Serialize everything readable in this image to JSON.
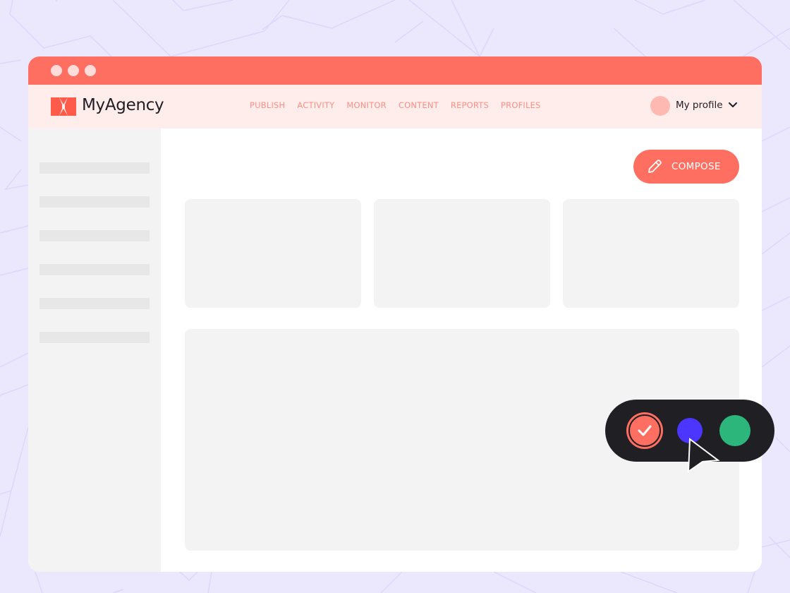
{
  "app": {
    "brand_name": "MyAgency",
    "window_dots": [
      "close",
      "minimize",
      "maximize"
    ]
  },
  "nav": {
    "links": [
      {
        "label": "PUBLISH"
      },
      {
        "label": "ACTIVITY"
      },
      {
        "label": "MONITOR"
      },
      {
        "label": "CONTENT"
      },
      {
        "label": "REPORTS"
      },
      {
        "label": "PROFILES"
      }
    ],
    "profile_label": "My profile",
    "profile_icon": "chevron-down-icon"
  },
  "sidebar": {
    "items": [
      {
        "placeholder": true
      },
      {
        "placeholder": true
      },
      {
        "placeholder": true
      },
      {
        "placeholder": true
      },
      {
        "placeholder": true
      },
      {
        "placeholder": true
      }
    ]
  },
  "main": {
    "compose_label": "COMPOSE",
    "compose_icon": "pencil-icon",
    "cards": [
      {
        "placeholder": true
      },
      {
        "placeholder": true
      },
      {
        "placeholder": true
      }
    ],
    "panel": {
      "placeholder": true
    }
  },
  "color_picker": {
    "swatches": [
      {
        "name": "coral",
        "color": "#ff6f61",
        "selected": true
      },
      {
        "name": "blue",
        "color": "#4b35ff",
        "selected": false
      },
      {
        "name": "green",
        "color": "#2db67c",
        "selected": false
      }
    ]
  },
  "colors": {
    "accent": "#ff6f61",
    "nav_bg": "#ffedeb",
    "nav_text": "#ff8f85",
    "page_bg": "#ebe8fe",
    "dark": "#201f24"
  }
}
